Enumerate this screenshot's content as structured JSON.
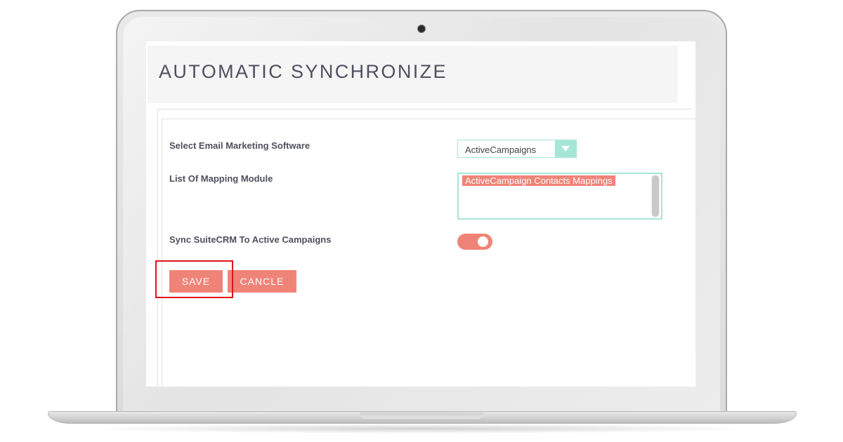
{
  "page": {
    "title": "AUTOMATIC SYNCHRONIZE"
  },
  "form": {
    "email_software": {
      "label": "Select Email Marketing Software",
      "value": "ActiveCampaigns"
    },
    "mapping_module": {
      "label": "List Of Mapping Module",
      "options": [
        "ActiveCampaign Contacts Mappings"
      ],
      "selected": "ActiveCampaign Contacts Mappings"
    },
    "sync": {
      "label": "Sync SuiteCRM To Active Campaigns",
      "enabled": true
    }
  },
  "actions": {
    "save_label": "SAVE",
    "cancel_label": "CANCLE"
  },
  "icons": {
    "select_arrow": "chevron-down-icon",
    "camera": "camera-icon"
  },
  "colors": {
    "accent": "#f08377",
    "select_border": "#a6e6d6",
    "title_text": "#4f4f5f",
    "highlight": "#e0141c"
  }
}
